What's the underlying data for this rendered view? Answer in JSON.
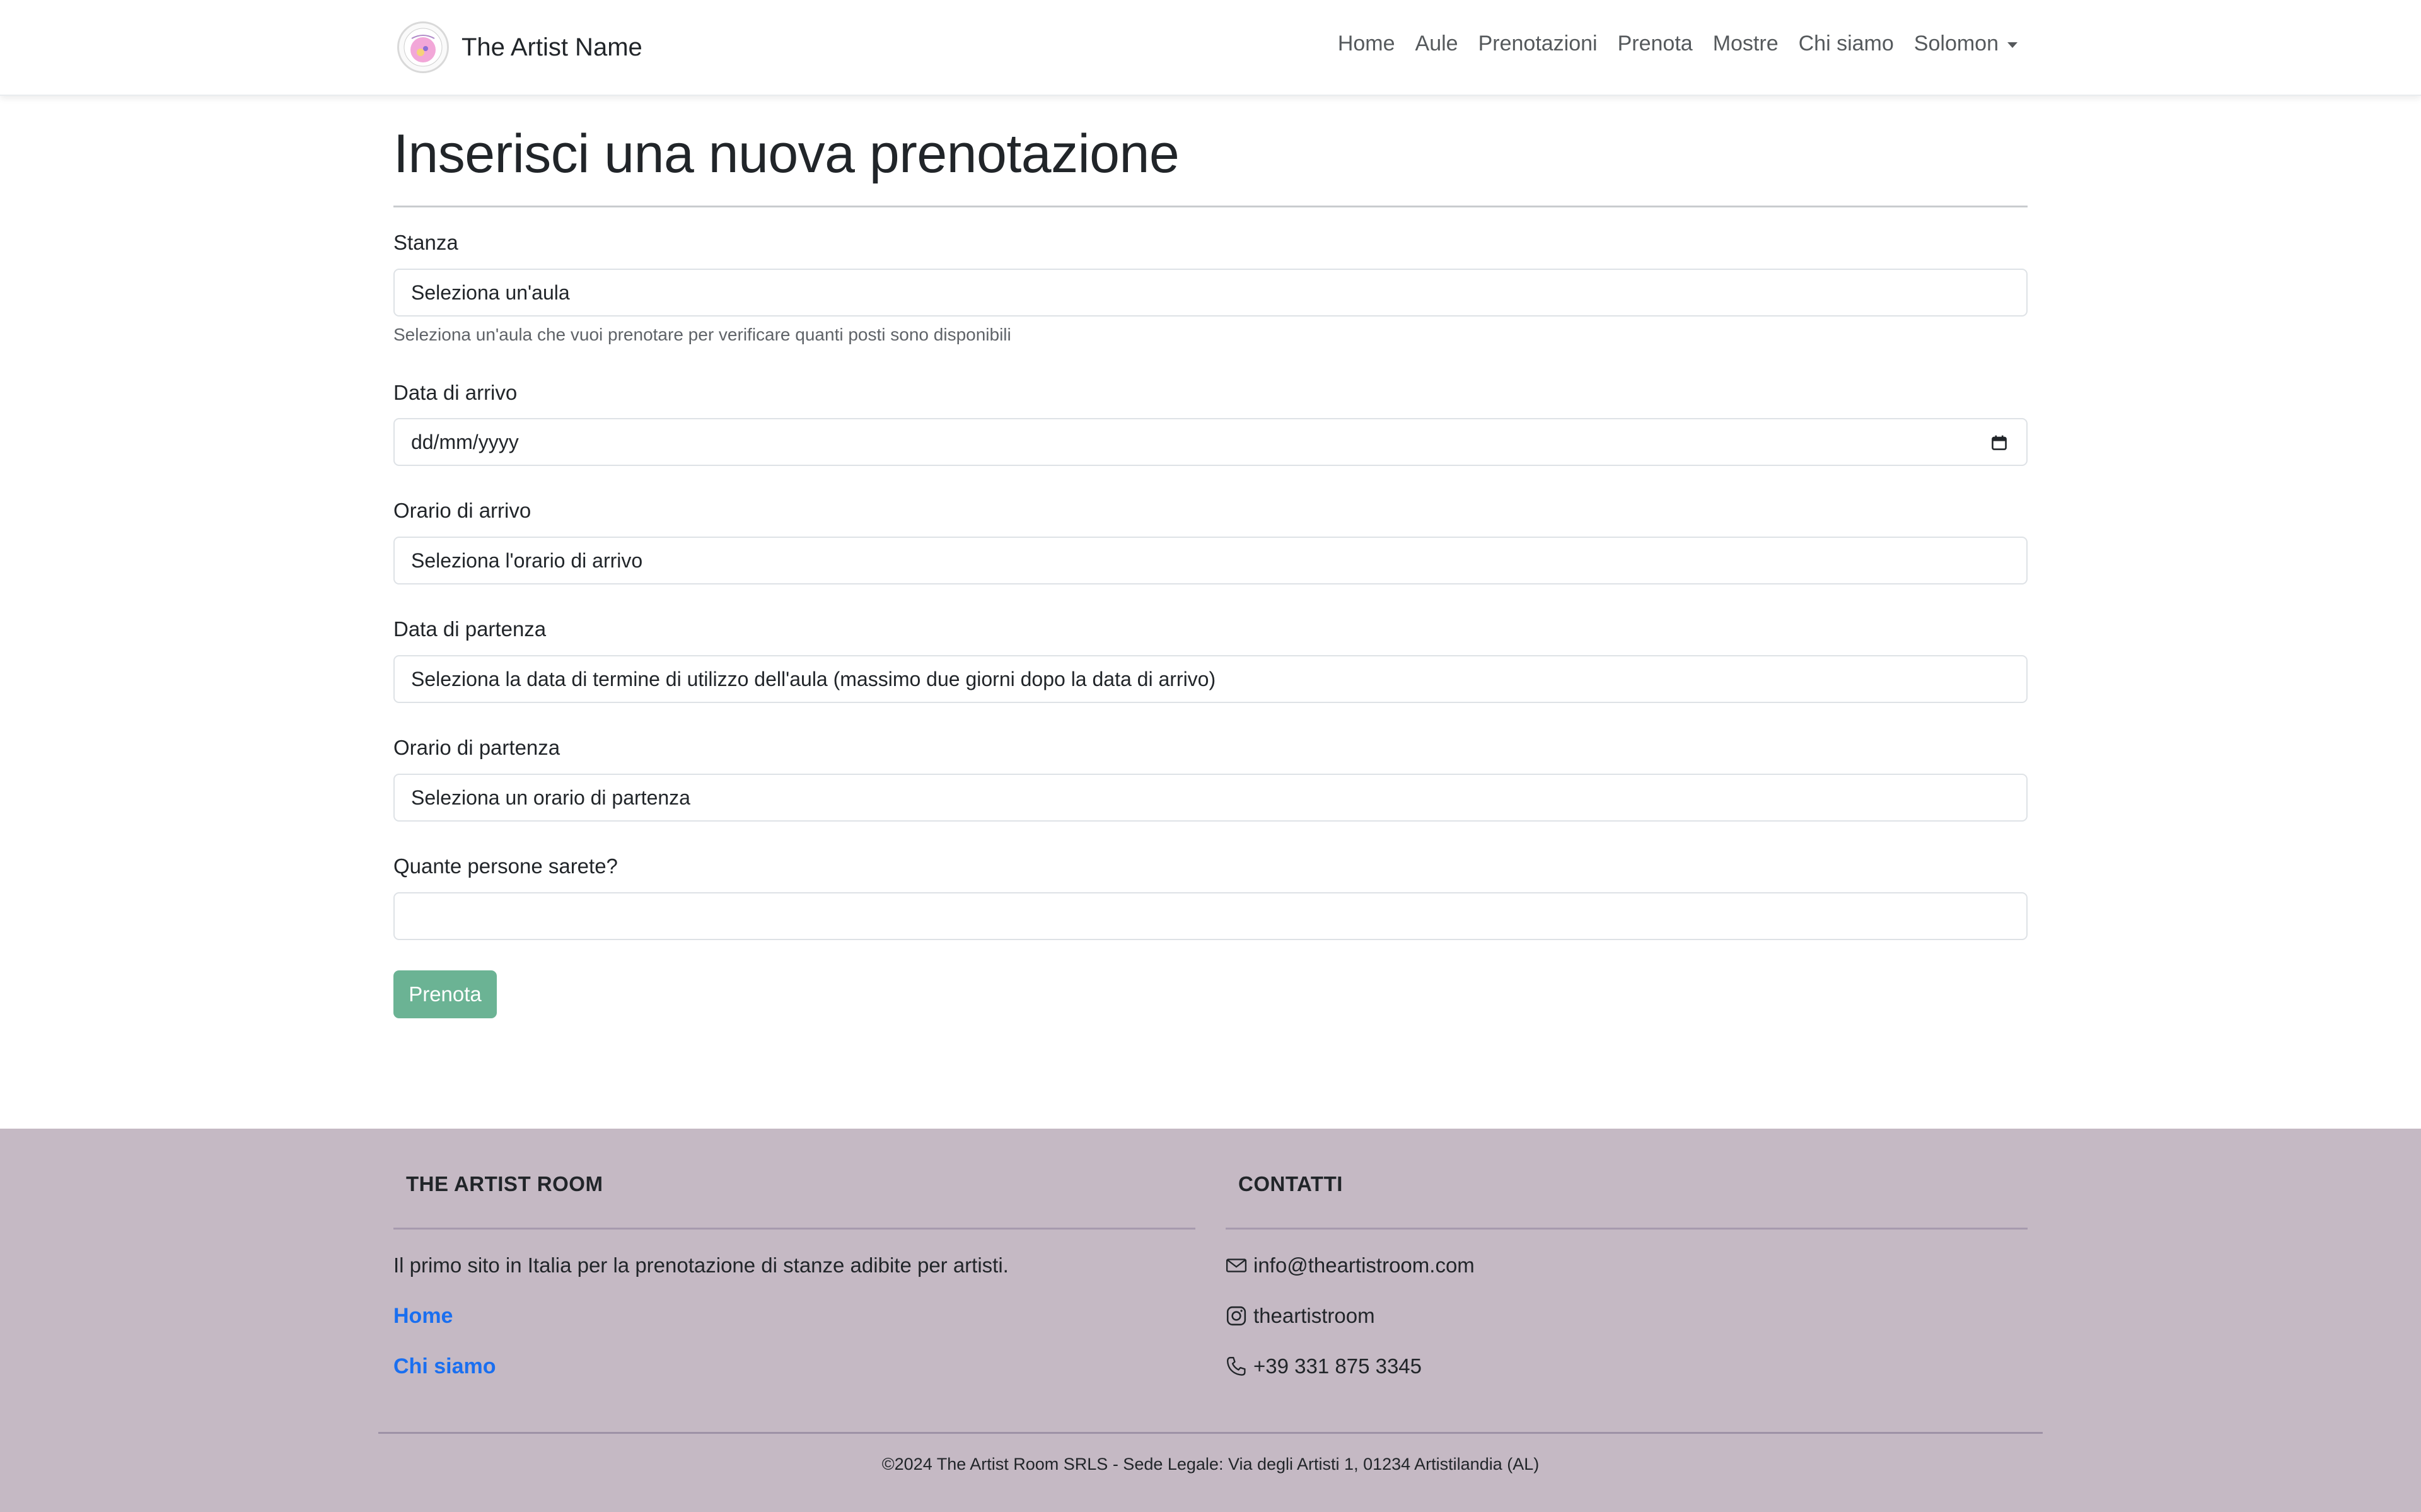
{
  "navbar": {
    "brand_name": "The Artist Name",
    "links": [
      "Home",
      "Aule",
      "Prenotazioni",
      "Prenota",
      "Mostre",
      "Chi siamo"
    ],
    "user_menu": "Solomon"
  },
  "main": {
    "title": "Inserisci una nuova prenotazione",
    "stanza": {
      "label": "Stanza",
      "value": "Seleziona un'aula",
      "help": "Seleziona un'aula che vuoi prenotare per verificare quanti posti sono disponibili"
    },
    "data_arrivo": {
      "label": "Data di arrivo",
      "placeholder": "dd/mm/yyyy"
    },
    "orario_arrivo": {
      "label": "Orario di arrivo",
      "value": "Seleziona l'orario di arrivo"
    },
    "data_partenza": {
      "label": "Data di partenza",
      "value": "Seleziona la data di termine di utilizzo dell'aula (massimo due giorni dopo la data di arrivo)"
    },
    "orario_partenza": {
      "label": "Orario di partenza",
      "value": "Seleziona un orario di partenza"
    },
    "persone": {
      "label": "Quante persone sarete?",
      "value": ""
    },
    "submit_label": "Prenota"
  },
  "footer": {
    "col1_heading": "THE ARTIST ROOM",
    "col1_text": "Il primo sito in Italia per la prenotazione di stanze adibite per artisti.",
    "col1_links": [
      "Home",
      "Chi siamo"
    ],
    "col2_heading": "CONTATTI",
    "email": "info@theartistroom.com",
    "instagram": "theartistroom",
    "phone": "+39 331 875 3345",
    "copyright": "©2024 The Artist Room SRLS - Sede Legale: Via degli Artisti 1, 01234 Artistilandia (AL)"
  },
  "colors": {
    "accent_button": "#6bb394",
    "footer_bg": "#c5b9c4",
    "link": "#1a6ff0"
  },
  "icons": [
    "logo-icon",
    "chevron-down-icon",
    "calendar-icon",
    "envelope-icon",
    "instagram-icon",
    "phone-icon"
  ]
}
